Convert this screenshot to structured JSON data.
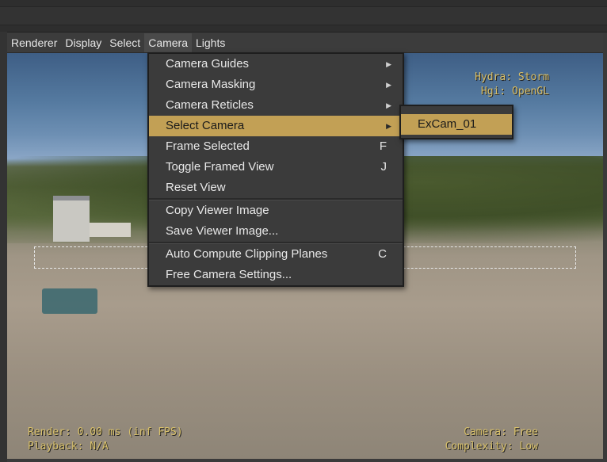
{
  "menubar": {
    "items": [
      "Renderer",
      "Display",
      "Select",
      "Camera",
      "Lights"
    ],
    "active": "Camera"
  },
  "hud": {
    "top_right_line1": "Hydra: Storm",
    "top_right_line2": "Hgi: OpenGL",
    "bottom_left_line1": "Render: 0.00 ms (inf FPS)",
    "bottom_left_line2": "Playback: N/A",
    "bottom_right_line1": "Camera: Free",
    "bottom_right_line2": "Complexity: Low"
  },
  "camera_menu": {
    "camera_guides": "Camera Guides",
    "camera_masking": "Camera Masking",
    "camera_reticles": "Camera Reticles",
    "select_camera": "Select Camera",
    "frame_selected": "Frame Selected",
    "frame_selected_shortcut": "F",
    "toggle_framed_view": "Toggle Framed View",
    "toggle_framed_view_shortcut": "J",
    "reset_view": "Reset View",
    "copy_viewer_image": "Copy Viewer Image",
    "save_viewer_image": "Save Viewer Image...",
    "auto_compute_clipping": "Auto Compute Clipping Planes",
    "auto_compute_clipping_shortcut": "C",
    "free_camera_settings": "Free Camera Settings..."
  },
  "select_camera_submenu": {
    "items": [
      "ExCam_01"
    ]
  },
  "icons": {
    "submenu_arrow": "chevron-right-icon"
  },
  "colors": {
    "menu_highlight": "#c2a055",
    "hud_text": "#d8c06a",
    "menu_bg": "#3b3b3b"
  }
}
